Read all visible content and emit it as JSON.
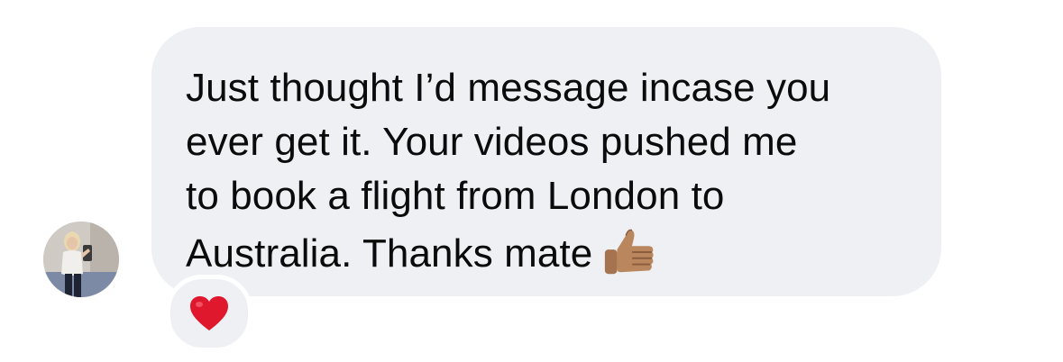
{
  "message": {
    "sender_avatar_icon": "profile-photo",
    "lines": [
      "Just thought I’d message incase you",
      "ever get it. Your videos pushed me",
      "to book a flight from London to",
      "Australia. Thanks mate"
    ],
    "trailing_emoji": "thumbs-up-icon",
    "bubble_color": "#eef0f4",
    "text_color": "#0b0b0c"
  },
  "reaction": {
    "emoji": "red-heart-icon",
    "color": "#e0182d"
  }
}
